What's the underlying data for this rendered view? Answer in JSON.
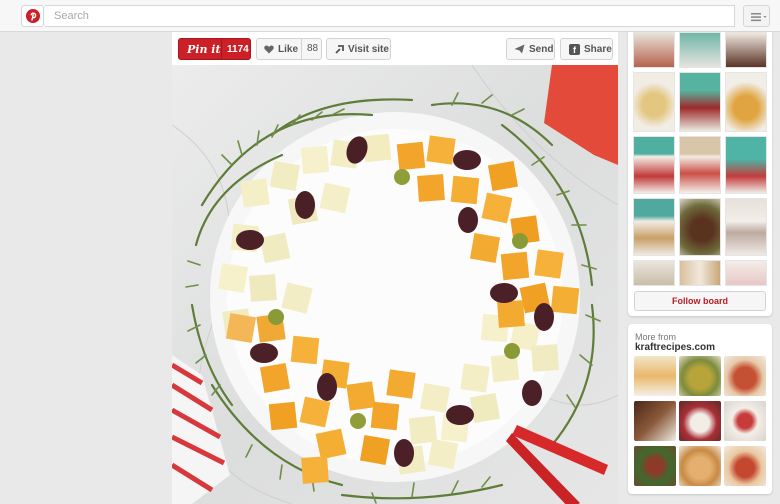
{
  "topbar": {
    "search_placeholder": "Search"
  },
  "pin": {
    "pinit_label": "Pin it",
    "pinit_count": "1174",
    "like_label": "Like",
    "like_count": "88",
    "visit_label": "Visit site",
    "send_label": "Send",
    "share_label": "Share"
  },
  "sidebar": {
    "follow_label": "Follow board",
    "more_from_label": "More from",
    "more_from_site": "kraftrecipes.com"
  },
  "colors": {
    "brand_red": "#cb2027",
    "page_background": "#e9e9e9"
  },
  "icons": [
    "pinterest-logo-icon",
    "menu-icon",
    "heart-icon",
    "visit-site-icon",
    "send-icon",
    "facebook-icon"
  ]
}
